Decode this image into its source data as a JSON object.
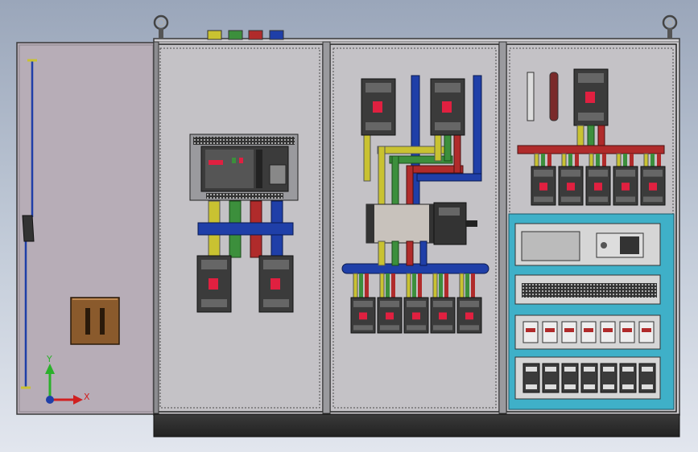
{
  "colors": {
    "phase_yellow": "#c9c231",
    "phase_green": "#3c8f3c",
    "phase_red": "#b02b2b",
    "phase_blue": "#1f3fa8",
    "cabinet_panel": "#c4c2c6",
    "cabinet_frame": "#4a4a4a",
    "door_panel": "#b7adb7",
    "plc_rail": "#3fb0c8",
    "breaker_body": "#3b3b3b",
    "breaker_handle": "#e02040",
    "plinth": "#2f2f2f",
    "handle_box": "#8a5a2c"
  },
  "axis_triad": {
    "x_label": "X",
    "y_label": "Y"
  }
}
